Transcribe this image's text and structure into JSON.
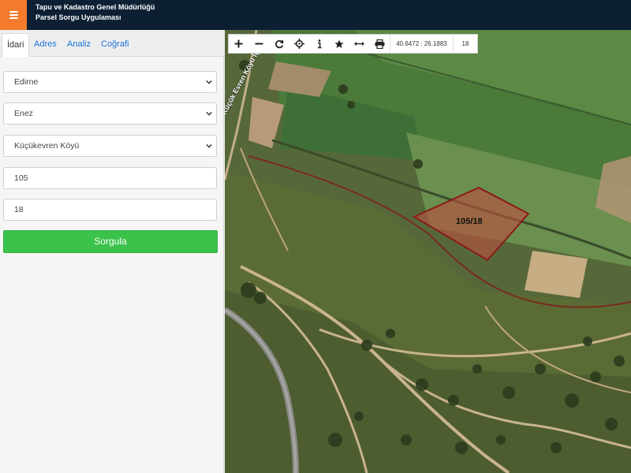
{
  "header": {
    "org_title": "Tapu ve Kadastro Genel Müdürlüğü",
    "app_title": "Parsel Sorgu Uygulaması",
    "accent_color": "#f47b2c",
    "bar_color": "#0c1f33"
  },
  "sidebar": {
    "tabs": [
      {
        "label": "İdari",
        "active": true
      },
      {
        "label": "Adres",
        "active": false
      },
      {
        "label": "Analiz",
        "active": false
      },
      {
        "label": "Coğrafi",
        "active": false
      }
    ],
    "province": {
      "value": "Edirne"
    },
    "district": {
      "value": "Enez"
    },
    "neighborhood": {
      "value": "Küçükevren Köyü"
    },
    "block_no": {
      "value": "105"
    },
    "parcel_no": {
      "value": "18"
    },
    "query_button": "Sorgula",
    "query_button_color": "#3bc24a"
  },
  "map": {
    "toolbar": {
      "icons": [
        "zoom-in-icon",
        "zoom-out-icon",
        "refresh-icon",
        "locate-icon",
        "info-icon",
        "favorite-icon",
        "measure-icon",
        "print-icon"
      ],
      "coordinates": "40.6472 : 26.1883",
      "zoom_level": "18"
    },
    "parcel_label": "105/18",
    "road_label": "Küçük Evren Köyü İç Yolu",
    "parcel_outline_color": "#8b1a1a"
  }
}
